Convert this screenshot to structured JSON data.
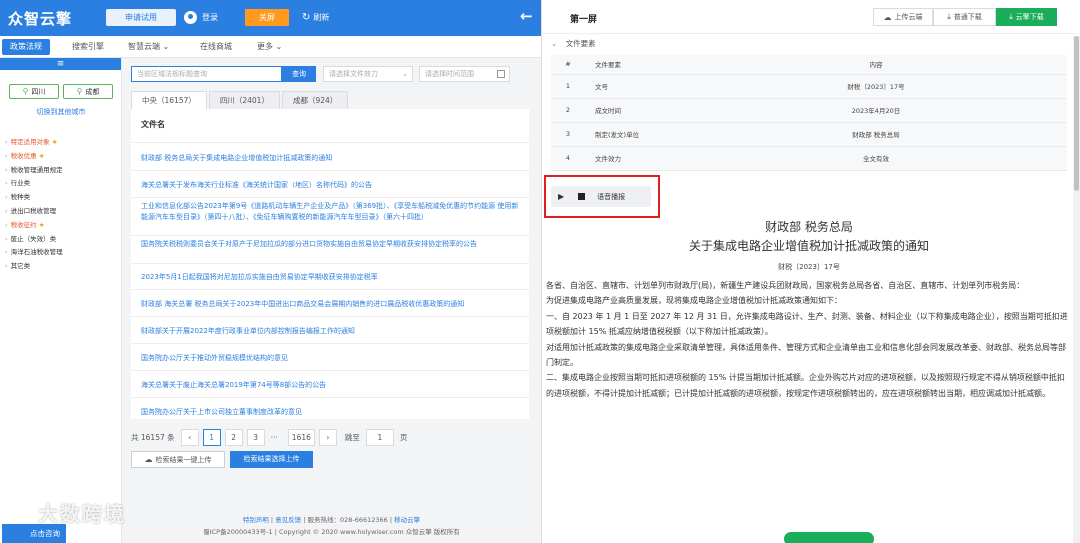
{
  "header": {
    "logo": "众智云擎",
    "trial": "申请试用",
    "login": "登录",
    "close": "关屏",
    "refresh": "刷新",
    "back_icon": "arrow-left-icon"
  },
  "nav": {
    "items": [
      {
        "label": "政策法规"
      },
      {
        "label": "搜索引擎"
      },
      {
        "label": "智慧云端 ⌄"
      },
      {
        "label": "在线商城"
      },
      {
        "label": "更多 ⌄"
      }
    ]
  },
  "sidebar": {
    "head": "≡",
    "city1": "四川",
    "city2": "成都",
    "switch_city": "切换到其他城市",
    "categories": [
      {
        "label": "特定适用对象"
      },
      {
        "label": "税收优惠"
      },
      {
        "label": "税收管理通用规定"
      },
      {
        "label": "行业类"
      },
      {
        "label": "税种类"
      },
      {
        "label": "进出口税收管理"
      },
      {
        "label": "税收征约"
      },
      {
        "label": "废止（失效）类"
      },
      {
        "label": "海洋石油税收管理"
      },
      {
        "label": "其它类"
      }
    ]
  },
  "search": {
    "placeholder": "当前区域法规标题查询",
    "button": "查询",
    "filter_effect": "请选择文件效力",
    "filter_date": "请选择时间范围"
  },
  "tabs": [
    {
      "label": "中央（16157）"
    },
    {
      "label": "四川（2401）"
    },
    {
      "label": "成都（924）"
    }
  ],
  "list": {
    "header": "文件名",
    "rows": [
      "财政部 税务总局关于集成电路企业增值税加计抵减政策的通知",
      "海关总署关于发布海关行业标准《海关统计国家（地区）名称代码》的公告",
      "工业和信息化部公告2023年第9号《道路机动车辆生产企业及产品》（第369批）、《享受车船税减免优惠的节约能源 使用新能源汽车车型目录》（第四十八批）、《免征车辆购置税的新能源汽车车型目录》（第六十四批）",
      "国务院关税税则委员会关于对原产于尼加拉瓜的部分进口货物实施自由贸易协定早期收获安排协定税率的公告",
      "2023年5月1日起我国将对尼加拉瓜实施自由贸易协定早期收获安排协定税率",
      "财政部 海关总署 税务总局关于2023年中国进出口商品交易会展期内销售的进口展品税收优惠政策的通知",
      "财政部关于开展2022年度行政事业单位内部控制报告编报工作的通知",
      "国务院办公厅关于推动外贸稳规模优结构的意见",
      "海关总署关于废止海关总署2019年第74号等8部公告的公告",
      "国务院办公厅关于上市公司独立董事制度改革的意见"
    ]
  },
  "pager": {
    "total": "共 16157 条",
    "prev": "‹",
    "p1": "1",
    "p2": "2",
    "p3": "3",
    "ellipsis": "···",
    "last": "1616",
    "next": "›",
    "jump_label": "跳至",
    "jump_value": "1",
    "page_unit": "页"
  },
  "actions": {
    "upload_all": "检索结果一键上传",
    "upload_selected": "检索结果选择上传"
  },
  "footer": {
    "line1_a": "特别声明",
    "line1_b": "意见反馈",
    "line1_c": "服务热线：028-66612366",
    "line1_d": "移动云擎",
    "line2": "蜀ICP备20000433号-1 | Copyright © 2020 www.holywiser.com 众智云擎 版权所有"
  },
  "watermark": "大数跨境",
  "consult": "点击咨询",
  "right": {
    "title": "第一屏",
    "upload_cloud": "上传云端",
    "normal_download": "普通下载",
    "cloud_download": "云擎下载",
    "meta_section": "文件要素",
    "meta_headers": [
      "#",
      "文件要素",
      "内容"
    ],
    "meta_rows": [
      [
        "1",
        "文号",
        "财税〔2023〕17号"
      ],
      [
        "2",
        "成文时间",
        "2023年4月20日"
      ],
      [
        "3",
        "制定(发文)单位",
        "财政部 税务总局"
      ],
      [
        "4",
        "文件效力",
        "全文有效"
      ]
    ],
    "voice_label": "语音播报",
    "doc_title1": "财政部 税务总局",
    "doc_title2": "关于集成电路企业增值税加计抵减政策的通知",
    "doc_number": "财税〔2023〕17号",
    "paragraphs": [
      "各省、自治区、直辖市、计划单列市财政厅(局)，新疆生产建设兵团财政局，国家税务总局各省、自治区、直辖市、计划单列市税务局：",
      "为促进集成电路产业高质量发展，现将集成电路企业增值税加计抵减政策通知如下：",
      "一、自 2023 年 1 月 1 日至 2027 年 12 月 31 日，允许集成电路设计、生产、封测、装备、材料企业（以下称集成电路企业），按照当期可抵扣进项税额加计 15% 抵减应纳增值税税额（以下称加计抵减政策）。",
      "对适用加计抵减政策的集成电路企业采取清单管理，具体适用条件、管理方式和企业清单由工业和信息化部会同发展改革委、财政部、税务总局等部门制定。",
      "二、集成电路企业按照当期可抵扣进项税额的 15% 计提当期加计抵减额。企业外购芯片对应的进项税额，以及按照现行规定不得从销项税额中抵扣的进项税额，不得计提加计抵减额；已计提加计抵减额的进项税额，按规定作进项税额转出的，应在进项税额转出当期，相应调减加计抵减额。"
    ]
  },
  "colors": {
    "brand": "#2b7fe0",
    "orange": "#ff9a1f",
    "green": "#1aad5a",
    "red": "#e02020"
  }
}
